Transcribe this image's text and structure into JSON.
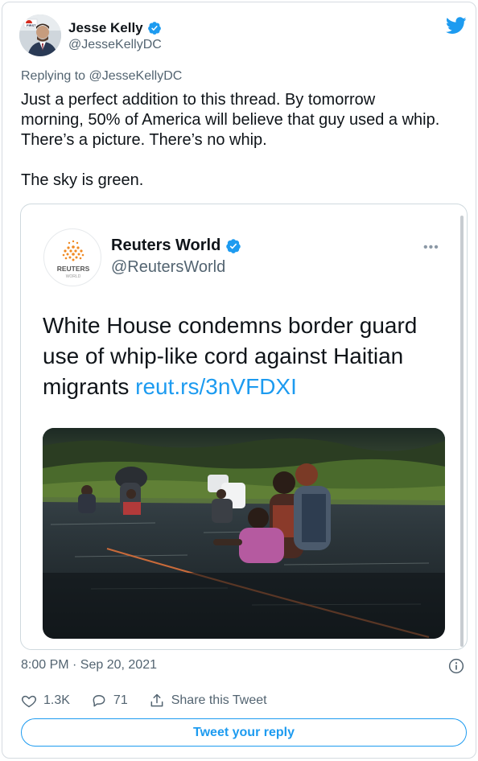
{
  "colors": {
    "accent": "#1d9bf0",
    "muted": "#536471",
    "text": "#0f1419",
    "border": "#cfd9de"
  },
  "author": {
    "name": "Jesse Kelly",
    "handle": "@JesseKellyDC",
    "verified": true,
    "avatar_badge": "FIRST"
  },
  "reply_context": {
    "prefix": "Replying to ",
    "handle": "@JesseKellyDC"
  },
  "tweet": {
    "lines": [
      "Just a perfect addition to this thread. By tomorrow",
      "morning, 50% of America will believe that guy used a whip.",
      "There’s a picture. There’s no whip."
    ],
    "closing": "The sky is green."
  },
  "quoted_tweet": {
    "name": "Reuters World",
    "handle": "@ReutersWorld",
    "verified": true,
    "avatar_label": "REUTERS",
    "avatar_sublabel": "WORLD",
    "more": "•••",
    "text": "White House condemns border guard use of whip-like cord against Haitian migrants ",
    "url": "reut.rs/3nVFDXI",
    "image": "migrants wading through river at dusk"
  },
  "meta": {
    "timestamp": "8:00 PM · Sep 20, 2021"
  },
  "actions": {
    "likes": "1.3K",
    "replies": "71",
    "share": "Share this Tweet"
  },
  "reply_button": "Tweet your reply",
  "icons": [
    "verified-icon",
    "twitter-bird-icon",
    "more-icon",
    "info-icon",
    "heart-icon",
    "reply-icon",
    "share-icon"
  ]
}
